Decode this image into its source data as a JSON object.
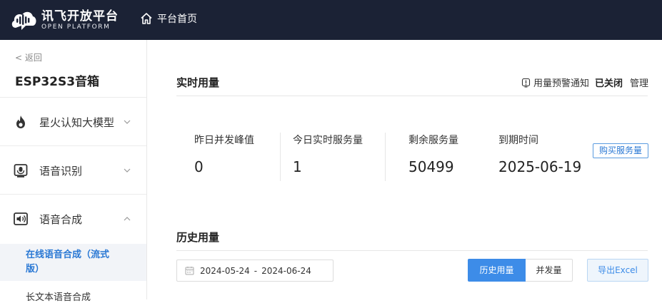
{
  "header": {
    "logo_title": "讯飞开放平台",
    "logo_subtitle": "OPEN PLATFORM",
    "home_label": "平台首页"
  },
  "sidebar": {
    "back_label": "< 返回",
    "app_name": "ESP32S3音箱",
    "items": [
      {
        "label": "星火认知大模型",
        "icon": "flame-icon",
        "expanded": false
      },
      {
        "label": "语音识别",
        "icon": "microphone-icon",
        "expanded": false
      },
      {
        "label": "语音合成",
        "icon": "speaker-icon",
        "expanded": true
      }
    ],
    "sub_items": [
      {
        "label": "在线语音合成（流式版）",
        "active": true
      },
      {
        "label": "长文本语音合成",
        "active": false
      }
    ]
  },
  "realtime": {
    "title": "实时用量",
    "alert_label": "用量预警通知",
    "alert_status": "已关闭",
    "manage_label": "管理",
    "stats": [
      {
        "label": "昨日并发峰值",
        "value": "0"
      },
      {
        "label": "今日实时服务量",
        "value": "1"
      },
      {
        "label": "剩余服务量",
        "value": "50499"
      },
      {
        "label": "到期时间",
        "value": "2025-06-19"
      }
    ],
    "buy_label": "购买服务量"
  },
  "history": {
    "title": "历史用量",
    "date_start": "2024-05-24",
    "date_separator": "-",
    "date_end": "2024-06-24",
    "tab_history": "历史用量",
    "tab_concurrency": "并发量",
    "export_label": "导出Excel"
  },
  "colors": {
    "topbar": "#1b2235",
    "accent": "#3d8ce8",
    "active_text": "#2a78d4"
  }
}
